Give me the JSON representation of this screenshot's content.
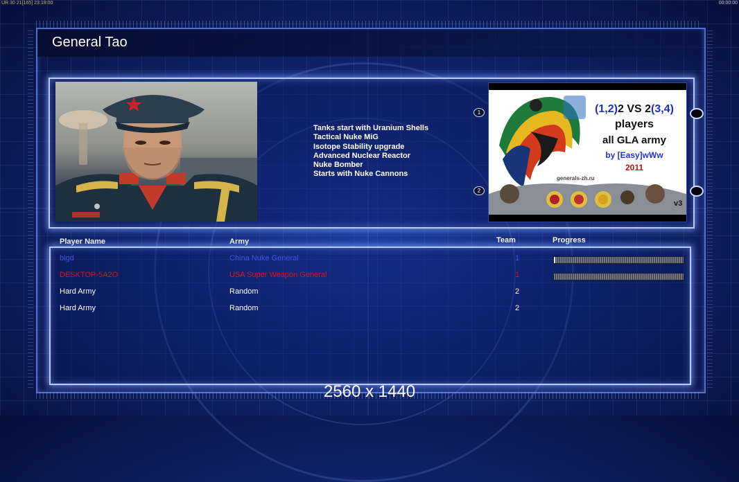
{
  "status_bar": {
    "left_text": "UR 30 21[165] 23:19:00",
    "right_text": "00:00:00"
  },
  "screen": {
    "title": "General Tao"
  },
  "general": {
    "bonuses": [
      "Tanks start with Uranium Shells",
      "Tactical Nuke MiG",
      "Isotope Stability upgrade",
      "Advanced Nuclear Reactor",
      "Nuke Bomber",
      "Starts with Nuke Cannons"
    ]
  },
  "map": {
    "title_line_prefix": "(1,2)",
    "title_line_mid": "2 VS 2",
    "title_line_suffix": "(3,4)",
    "line2": "players",
    "line3": "all GLA army",
    "line4": "by [Easy]wWw",
    "line5": "2011",
    "site": "generals-zh.ru",
    "version": "v3",
    "start_positions": [
      "1",
      "2"
    ]
  },
  "player_table": {
    "headers": {
      "name": "Player Name",
      "army": "Army",
      "team": "Team",
      "progress": "Progress"
    },
    "rows": [
      {
        "name": "bigd",
        "army": "China Nuke General",
        "team": "1",
        "color": "#3d55e6",
        "progress": 0.01
      },
      {
        "name": "DESKTOP-5A2O",
        "army": "USA Super Weapon General",
        "team": "1",
        "color": "#e01414",
        "progress": 0
      },
      {
        "name": "Hard Army",
        "army": "Random",
        "team": "2",
        "color": "#ffffff"
      },
      {
        "name": "Hard Army",
        "army": "Random",
        "team": "2",
        "color": "#ffffff"
      }
    ]
  },
  "resolution_label": "2560 x 1440"
}
